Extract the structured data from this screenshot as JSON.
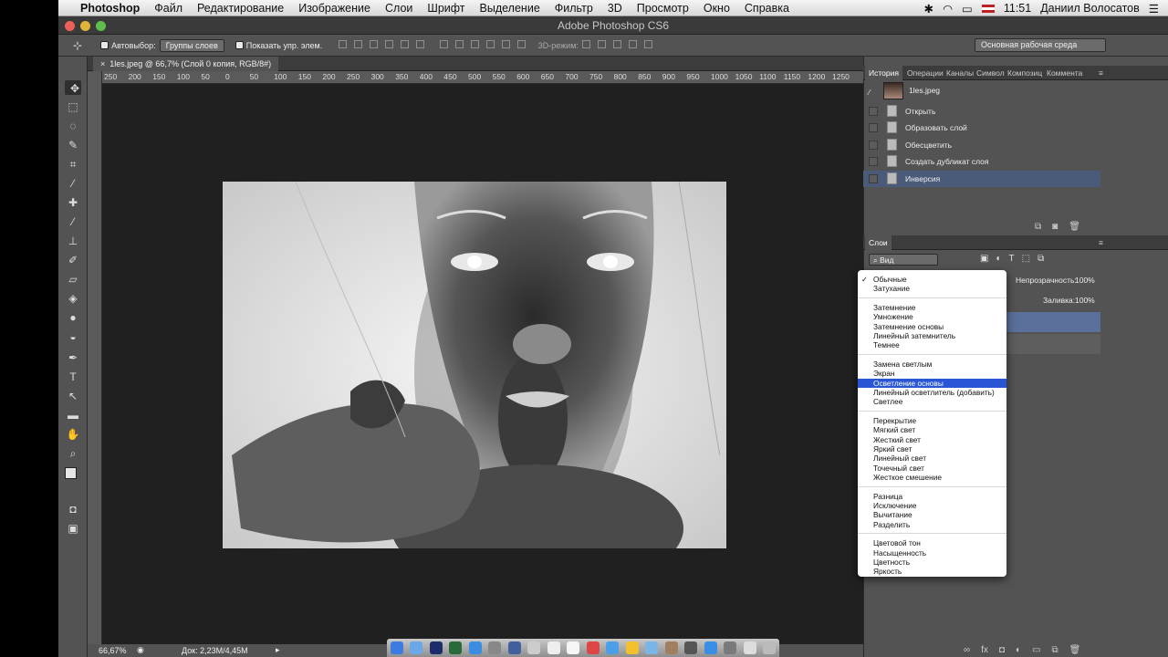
{
  "menubar": {
    "app": "Photoshop",
    "items": [
      "Файл",
      "Редактирование",
      "Изображение",
      "Слои",
      "Шрифт",
      "Выделение",
      "Фильтр",
      "3D",
      "Просмотр",
      "Окно",
      "Справка"
    ],
    "clock": "11:51",
    "user": "Даниил Волосатов"
  },
  "window": {
    "title": "Adobe Photoshop CS6"
  },
  "options": {
    "autoselect_label": "Автовыбор:",
    "autoselect_value": "Группы слоев",
    "show_controls": "Показать упр. элем.",
    "mode3d": "3D-режим:",
    "workspace": "Основная рабочая среда"
  },
  "document": {
    "tab": "1les.jpeg @ 66,7% (Слой 0 копия, RGB/8#)",
    "zoom": "66,67%",
    "doc_size": "Док: 2,23M/4,45M"
  },
  "ruler": {
    "ticks": [
      "250",
      "200",
      "150",
      "100",
      "50",
      "0",
      "50",
      "100",
      "150",
      "200",
      "250",
      "300",
      "350",
      "400",
      "450",
      "500",
      "550",
      "600",
      "650",
      "700",
      "750",
      "800",
      "850",
      "900",
      "950",
      "1000",
      "1050",
      "1100",
      "1150",
      "1200",
      "1250"
    ]
  },
  "history": {
    "tabs": [
      "История",
      "Операции",
      "Каналы",
      "Символ",
      "Композиц",
      "Коммента"
    ],
    "snapshot": "1les.jpeg",
    "steps": [
      "Открыть",
      "Образовать слой",
      "Обесцветить",
      "Создать дубликат слоя",
      "Инверсия"
    ],
    "active_step": 4
  },
  "layers": {
    "tab": "Слои",
    "filter": "Вид",
    "opacity_label": "Непрозрачность:",
    "opacity": "100%",
    "fill_label": "Заливка:",
    "fill": "100%"
  },
  "blend_modes": {
    "groups": [
      [
        "Обычные",
        "Затухание"
      ],
      [
        "Затемнение",
        "Умножение",
        "Затемнение основы",
        "Линейный затемнитель",
        "Темнее"
      ],
      [
        "Замена светлым",
        "Экран",
        "Осветление основы",
        "Линейный осветлитель (добавить)",
        "Светлее"
      ],
      [
        "Перекрытие",
        "Мягкий свет",
        "Жесткий свет",
        "Яркий свет",
        "Линейный свет",
        "Точечный свет",
        "Жесткое смешение"
      ],
      [
        "Разница",
        "Исключение",
        "Вычитание",
        "Разделить"
      ],
      [
        "Цветовой тон",
        "Насыщенность",
        "Цветность",
        "Яркость"
      ]
    ],
    "checked": "Обычные",
    "highlighted": "Осветление основы"
  },
  "colors": {
    "accent": "#2a56d6",
    "panel": "#535353",
    "canvas": "#202020"
  }
}
